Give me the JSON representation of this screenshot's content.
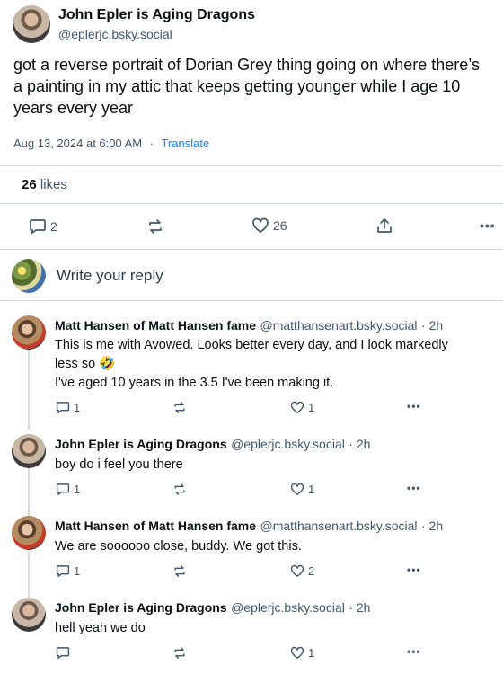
{
  "post": {
    "author_name": "John Epler is Aging Dragons",
    "author_handle": "@eplerjc.bsky.social",
    "text": "got a reverse portrait of Dorian Grey thing going on where there’s a painting in my attic that keeps getting younger while I age 10 years every year",
    "timestamp": "Aug 13, 2024 at 6:00 AM",
    "separator": "·",
    "translate": "Translate",
    "likes_count": "26",
    "likes_label": "likes",
    "actions": {
      "replies": "2",
      "likes": "26"
    }
  },
  "composer": {
    "placeholder": "Write your reply"
  },
  "replies": [
    {
      "name": "Matt Hansen of Matt Hansen fame",
      "handle": "@matthansenart.bsky.social",
      "time": "· 2h",
      "line1": "This is me with Avowed. Looks better every day, and I look markedly",
      "line2": "less so 🤣",
      "line3": "I've aged 10 years in the 3.5 I've been making it.",
      "reply_count": "1",
      "like_count": "1"
    },
    {
      "name": "John Epler is Aging Dragons",
      "handle": "@eplerjc.bsky.social",
      "time": "· 2h",
      "line1": "boy do i feel you there",
      "reply_count": "1",
      "like_count": "1"
    },
    {
      "name": "Matt Hansen of Matt Hansen fame",
      "handle": "@matthansenart.bsky.social",
      "time": "· 2h",
      "line1": "We are soooooo close, buddy. We got this.",
      "reply_count": "1",
      "like_count": "2"
    },
    {
      "name": "John Epler is Aging Dragons",
      "handle": "@eplerjc.bsky.social",
      "time": "· 2h",
      "line1": "hell yeah we do",
      "reply_count": "",
      "like_count": "1"
    }
  ],
  "icons": {
    "reply": "reply-icon",
    "repost": "repost-icon",
    "like": "heart-icon",
    "share": "share-icon",
    "more": "more-icon"
  },
  "colors": {
    "link": "#1083fe",
    "muted": "#42576c",
    "divider": "#d4dbe2"
  }
}
